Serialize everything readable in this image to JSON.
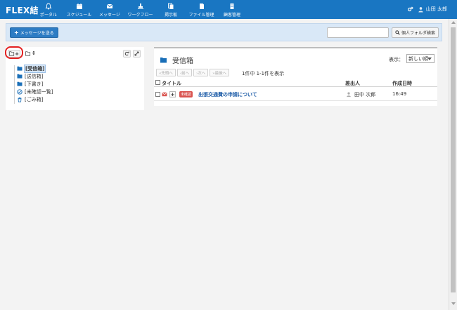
{
  "header": {
    "logo": "FLEX結",
    "nav": [
      {
        "label": "ポータル",
        "icon": "bell-icon"
      },
      {
        "label": "スケジュール",
        "icon": "calendar-icon"
      },
      {
        "label": "メッセージ",
        "icon": "envelope-icon"
      },
      {
        "label": "ワークフロー",
        "icon": "stamp-icon"
      },
      {
        "label": "掲示板",
        "icon": "documents-icon"
      },
      {
        "label": "ファイル管理",
        "icon": "file-icon"
      },
      {
        "label": "顧客管理",
        "icon": "building-icon"
      }
    ],
    "user_name": "山田 太郎"
  },
  "toolbar": {
    "send_label": "メッセージを送る",
    "search_value": "",
    "folder_search_label": "個人フォルダ検索"
  },
  "folders": [
    {
      "label": "[受信箱]",
      "icon": "folder-icon",
      "selected": true
    },
    {
      "label": "[送信箱]",
      "icon": "folder-icon",
      "selected": false
    },
    {
      "label": "[下書き]",
      "icon": "folder-icon",
      "selected": false
    },
    {
      "label": "[未確認一覧]",
      "icon": "check-circle-icon",
      "selected": false
    },
    {
      "label": "[ごみ箱]",
      "icon": "trash-icon",
      "selected": false
    }
  ],
  "content": {
    "title": "受信箱",
    "display_label": "表示：",
    "display_value": "新しい順",
    "pager": [
      "«先頭へ",
      "‹前へ",
      "›次へ",
      "»最後へ"
    ],
    "count_text": "1件中 1-1件を表示",
    "columns": {
      "title": "タイトル",
      "sender": "差出人",
      "date": "作成日時"
    },
    "rows": [
      {
        "badge": "未確認",
        "subject": "出張交通費の申請について",
        "sender": "田中 次郎",
        "time": "16:49"
      }
    ]
  },
  "colors": {
    "header": "#1976c2",
    "badge": "#d9534f",
    "link": "#1a5aa6",
    "highlight": "#e32020"
  }
}
